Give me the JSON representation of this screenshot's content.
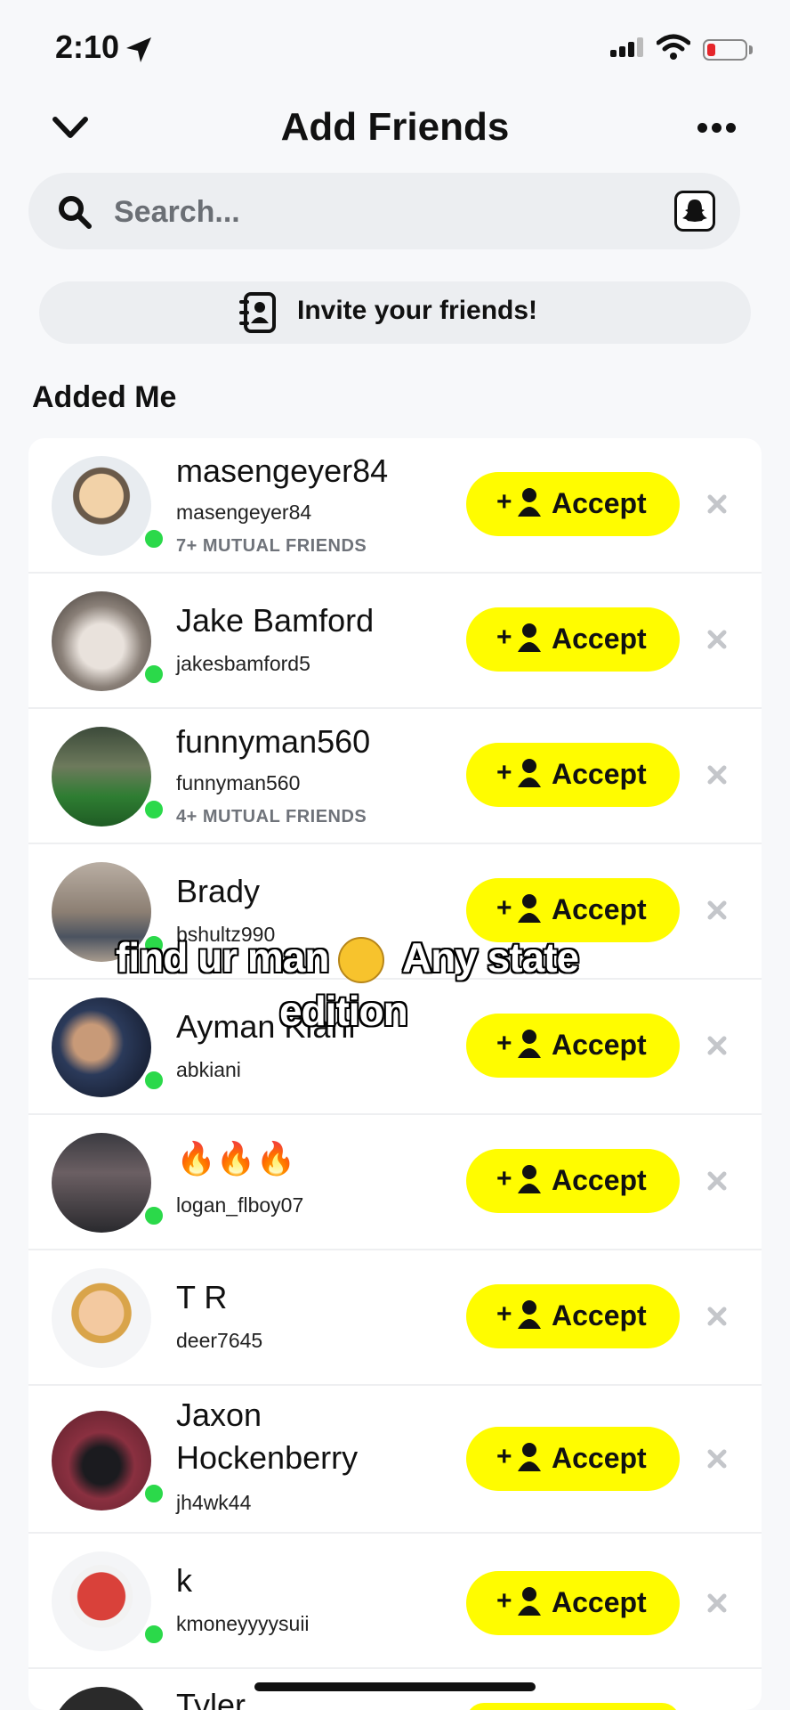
{
  "status_bar": {
    "time": "2:10"
  },
  "header": {
    "title": "Add Friends"
  },
  "search": {
    "placeholder": "Search..."
  },
  "invite": {
    "label": "Invite your friends!"
  },
  "section": {
    "title": "Added Me"
  },
  "accept_label": "Accept",
  "accept_plus": "+",
  "rows": [
    {
      "display_name": "masengeyer84",
      "username": "masengeyer84",
      "mutual": "7+ MUTUAL FRIENDS"
    },
    {
      "display_name": "Jake Bamford",
      "username": "jakesbamford5",
      "mutual": ""
    },
    {
      "display_name": "funnyman560",
      "username": "funnyman560",
      "mutual": "4+ MUTUAL FRIENDS"
    },
    {
      "display_name": "Brady",
      "username": "bshultz990",
      "mutual": ""
    },
    {
      "display_name": "Ayman Kiani",
      "username": "abkiani",
      "mutual": ""
    },
    {
      "display_name": "🔥🔥🔥",
      "username": "logan_flboy07",
      "mutual": ""
    },
    {
      "display_name": "T R",
      "username": "deer7645",
      "mutual": ""
    },
    {
      "display_name": "Jaxon Hockenberry",
      "display_name_line1": "Jaxon",
      "display_name_line2": "Hockenberry",
      "username": "jh4wk44",
      "mutual": ""
    },
    {
      "display_name": "k",
      "username": "kmoneyyyysuii",
      "mutual": ""
    },
    {
      "display_name": "Tyler",
      "username": "",
      "mutual": ""
    }
  ],
  "overlay": {
    "line1a": "find ur man",
    "line1b": "Any state",
    "line2": "edition"
  },
  "colors": {
    "accent": "#fffc00",
    "online": "#2bd94a"
  }
}
